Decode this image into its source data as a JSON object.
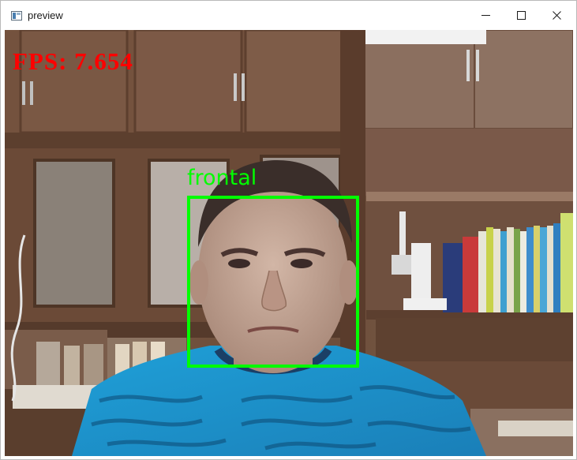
{
  "window": {
    "title": "preview",
    "app_icon": "window-app-icon",
    "controls": {
      "minimize_icon": "minimize-icon",
      "maximize_icon": "maximize-icon",
      "close_icon": "close-icon"
    }
  },
  "preview": {
    "fps_text": "FPS: 7.654",
    "detection_label": "frontal",
    "colors": {
      "fps_text": "#ff0000",
      "detection_box": "#00ff00"
    }
  }
}
